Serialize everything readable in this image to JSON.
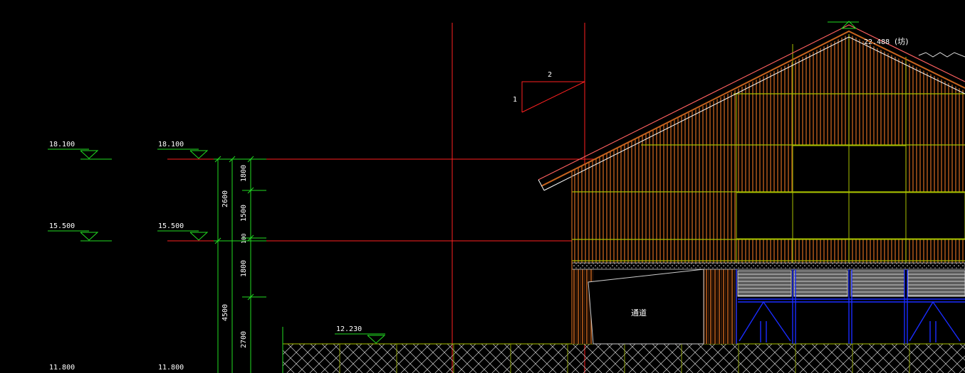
{
  "drawing": {
    "colors": {
      "background": "#000000",
      "red": "#ff2020",
      "green": "#22dd22",
      "yellow_green": "#a8c000",
      "orange_wood": "#c8641e",
      "blue": "#1a2cff",
      "white": "#ffffff",
      "gray": "#9a9a9a"
    },
    "levels_left": [
      {
        "label": "18.100"
      },
      {
        "label": "15.500"
      },
      {
        "label": "11.800"
      }
    ],
    "levels_mid": [
      {
        "label": "18.100"
      },
      {
        "label": "15.500"
      },
      {
        "label": "11.800"
      }
    ],
    "ground_level": {
      "label": "12.230"
    },
    "ridge_level": {
      "label": "22.488",
      "note": "(坊)"
    },
    "slope": {
      "rise": "1",
      "run": "2"
    },
    "dimensions_outer": [
      "2600",
      "4500"
    ],
    "dimensions_inner": [
      "1800",
      "1500",
      "100",
      "1800",
      "2700"
    ],
    "passage_label": "通道"
  }
}
